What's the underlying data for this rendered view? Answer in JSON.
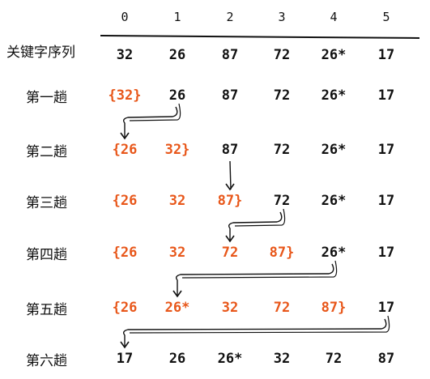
{
  "header_label": "关键字序列",
  "indices": [
    "0",
    "1",
    "2",
    "3",
    "4",
    "5"
  ],
  "initial": [
    "32",
    "26",
    "87",
    "72",
    "26*",
    "17"
  ],
  "passes": [
    {
      "label": "第一趟",
      "values": [
        "32",
        "26",
        "87",
        "72",
        "26*",
        "17"
      ],
      "sorted_count": 1
    },
    {
      "label": "第二趟",
      "values": [
        "26",
        "32",
        "87",
        "72",
        "26*",
        "17"
      ],
      "sorted_count": 2
    },
    {
      "label": "第三趟",
      "values": [
        "26",
        "32",
        "87",
        "72",
        "26*",
        "17"
      ],
      "sorted_count": 3
    },
    {
      "label": "第四趟",
      "values": [
        "26",
        "32",
        "72",
        "87",
        "26*",
        "17"
      ],
      "sorted_count": 4
    },
    {
      "label": "第五趟",
      "values": [
        "26",
        "26*",
        "32",
        "72",
        "87",
        "17"
      ],
      "sorted_count": 5
    },
    {
      "label": "第六趟",
      "values": [
        "17",
        "26",
        "26*",
        "32",
        "72",
        "87"
      ],
      "sorted_count": 0
    }
  ],
  "moves": [
    {
      "from_row": 0,
      "from_col": 1,
      "to_row": 1,
      "to_col": 0
    },
    {
      "from_row": 1,
      "from_col": 2,
      "to_row": 2,
      "to_col": 2
    },
    {
      "from_row": 2,
      "from_col": 3,
      "to_row": 3,
      "to_col": 2
    },
    {
      "from_row": 3,
      "from_col": 4,
      "to_row": 4,
      "to_col": 1
    },
    {
      "from_row": 4,
      "from_col": 5,
      "to_row": 5,
      "to_col": 0
    }
  ],
  "colors": {
    "ink": "#111111",
    "sorted": "#e8571a"
  }
}
